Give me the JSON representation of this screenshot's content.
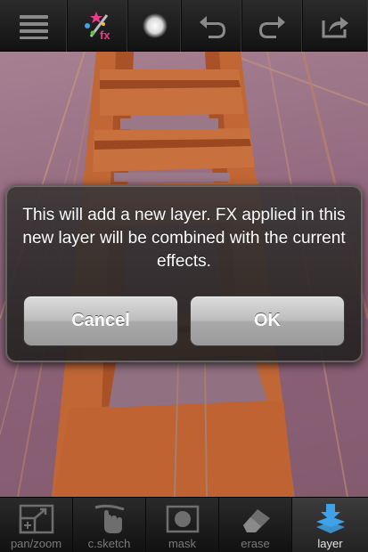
{
  "toolbar": {
    "menu_icon": "hamburger-menu-icon",
    "fx_icon": "magic-wand-fx-icon",
    "fx_label": "fx",
    "brush_icon": "brush-softness-icon",
    "undo_icon": "undo-icon",
    "redo_icon": "redo-icon",
    "share_icon": "share-export-icon"
  },
  "dialog": {
    "message": "This will add a new layer. FX applied in this new layer will be combined with the current effects.",
    "cancel_label": "Cancel",
    "ok_label": "OK"
  },
  "bottom_tabs": [
    {
      "label": "pan/zoom",
      "icon": "pan-zoom-icon",
      "active": false
    },
    {
      "label": "c.sketch",
      "icon": "hand-sketch-icon",
      "active": false
    },
    {
      "label": "mask",
      "icon": "mask-icon",
      "active": false
    },
    {
      "label": "erase",
      "icon": "eraser-icon",
      "active": false
    },
    {
      "label": "layer",
      "icon": "layer-icon",
      "active": true
    }
  ],
  "colors": {
    "accent_blue": "#3fa2e6",
    "tower_orange": "#d2703a",
    "sky": "#a07890"
  }
}
